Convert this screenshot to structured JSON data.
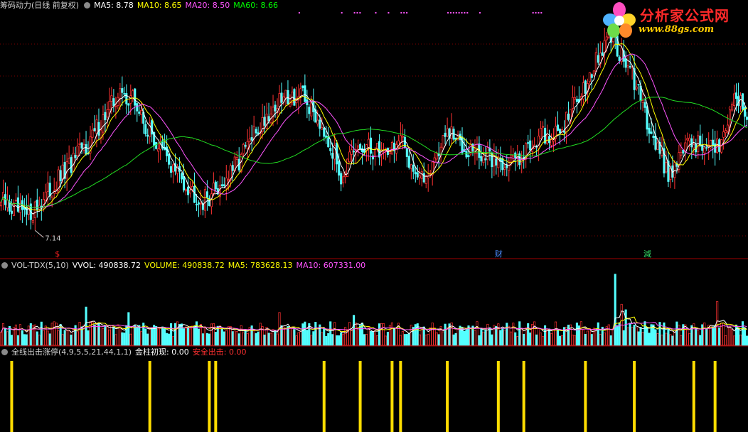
{
  "main_panel": {
    "title": "筹码动力(日线 前复权)",
    "ma_labels": [
      {
        "text": "MA5: 8.78",
        "color": "#ffffff"
      },
      {
        "text": "MA10: 8.65",
        "color": "#ffff00"
      },
      {
        "text": "MA20: 8.50",
        "color": "#ff55ff"
      },
      {
        "text": "MA60: 8.66",
        "color": "#00ff00"
      }
    ],
    "low_label": "7.14",
    "markers": [
      {
        "text": "$",
        "index": 27,
        "color": "#ff2020"
      },
      {
        "text": "财",
        "index": 234,
        "color": "#4a8aff"
      },
      {
        "text": "減",
        "index": 304,
        "color": "#33dd66"
      }
    ]
  },
  "volume_panel": {
    "labels": [
      {
        "text": "VOL-TDX(5,10)",
        "color": "#cfcfcf"
      },
      {
        "text": "VVOL: 490838.72",
        "color": "#ffffff"
      },
      {
        "text": "VOLUME: 490838.72",
        "color": "#ffff00"
      },
      {
        "text": "MA5: 783628.13",
        "color": "#ffff00"
      },
      {
        "text": "MA10: 607331.00",
        "color": "#ff55ff"
      }
    ]
  },
  "signal_panel": {
    "labels": [
      {
        "text": "全线出击涨停(4,9,5,5,21,44,1,1)",
        "color": "#cfcfcf"
      },
      {
        "text": "金柱初现: 0.00",
        "color": "#ffffff"
      },
      {
        "text": "安全出击: 0.00",
        "color": "#ff3030"
      }
    ]
  },
  "logo": {
    "title": "分析家公式网",
    "url": "www.88gs.com"
  },
  "colors": {
    "up": "#ff3232",
    "down": "#54ffff",
    "signal_bar": "#ffdd00",
    "grid": "#7a0000",
    "separator": "#a00000"
  },
  "chart_data": {
    "type": "candlestick",
    "anchors_close": [
      [
        0,
        7.6
      ],
      [
        12,
        7.2
      ],
      [
        22,
        7.8
      ],
      [
        40,
        9.0
      ],
      [
        48,
        9.7
      ],
      [
        55,
        10.3
      ],
      [
        62,
        10.2
      ],
      [
        68,
        9.5
      ],
      [
        80,
        8.5
      ],
      [
        95,
        7.6
      ],
      [
        108,
        8.3
      ],
      [
        125,
        9.8
      ],
      [
        135,
        10.3
      ],
      [
        142,
        10.2
      ],
      [
        152,
        9.5
      ],
      [
        160,
        8.3
      ],
      [
        168,
        8.9
      ],
      [
        180,
        8.9
      ],
      [
        188,
        9.1
      ],
      [
        198,
        8.1
      ],
      [
        210,
        9.3
      ],
      [
        228,
        8.7
      ],
      [
        240,
        8.6
      ],
      [
        252,
        9.2
      ],
      [
        262,
        9.3
      ],
      [
        276,
        10.7
      ],
      [
        287,
        11.8
      ],
      [
        296,
        10.9
      ],
      [
        308,
        9.1
      ],
      [
        314,
        8.3
      ],
      [
        322,
        9.0
      ],
      [
        330,
        9.1
      ],
      [
        336,
        8.8
      ],
      [
        346,
        10.4
      ],
      [
        351,
        9.7
      ]
    ],
    "signal_indices": [
      5,
      70,
      98,
      101,
      152,
      169,
      184,
      188,
      210,
      234,
      246,
      275,
      298,
      326,
      336
    ],
    "volume_spikes": [
      [
        40,
        1.4
      ],
      [
        289,
        2.6
      ],
      [
        292,
        1.5
      ],
      [
        337,
        1.6
      ],
      [
        294,
        1.3
      ],
      [
        60,
        1.2
      ],
      [
        131,
        1.2
      ],
      [
        166,
        1.1
      ]
    ],
    "n_bars": 352,
    "series": [
      {
        "name": "MA5",
        "values": [
          8.78
        ]
      },
      {
        "name": "MA10",
        "values": [
          8.65
        ]
      },
      {
        "name": "MA20",
        "values": [
          8.5
        ]
      },
      {
        "name": "MA60",
        "values": [
          8.66
        ]
      }
    ],
    "volume_series": [
      {
        "name": "VVOL",
        "values": [
          490838.72
        ]
      },
      {
        "name": "VOLUME",
        "values": [
          490838.72
        ]
      },
      {
        "name": "MA5",
        "values": [
          783628.13
        ]
      },
      {
        "name": "MA10",
        "values": [
          607331.0
        ]
      }
    ],
    "signal_series": [
      {
        "name": "金柱初现",
        "values": [
          0.0
        ]
      },
      {
        "name": "安全出击",
        "values": [
          0.0
        ]
      }
    ]
  }
}
